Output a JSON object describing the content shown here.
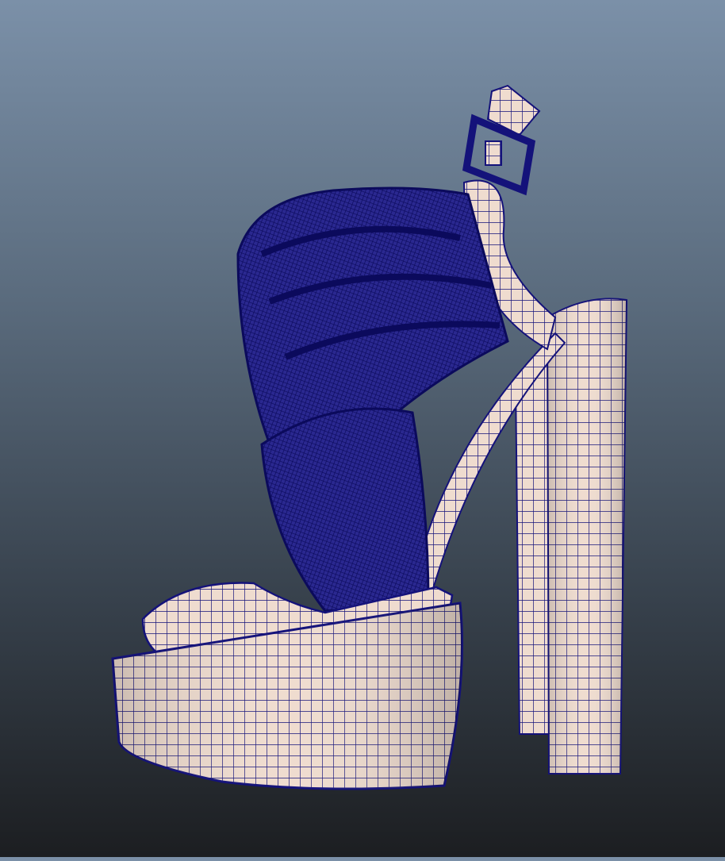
{
  "viewport": {
    "subject": "shoe-wireframe-model",
    "colors": {
      "background_top": "#7b90a8",
      "background_bottom": "#1c1e21",
      "surface": "#efdccf",
      "wire": "#14127a"
    }
  }
}
